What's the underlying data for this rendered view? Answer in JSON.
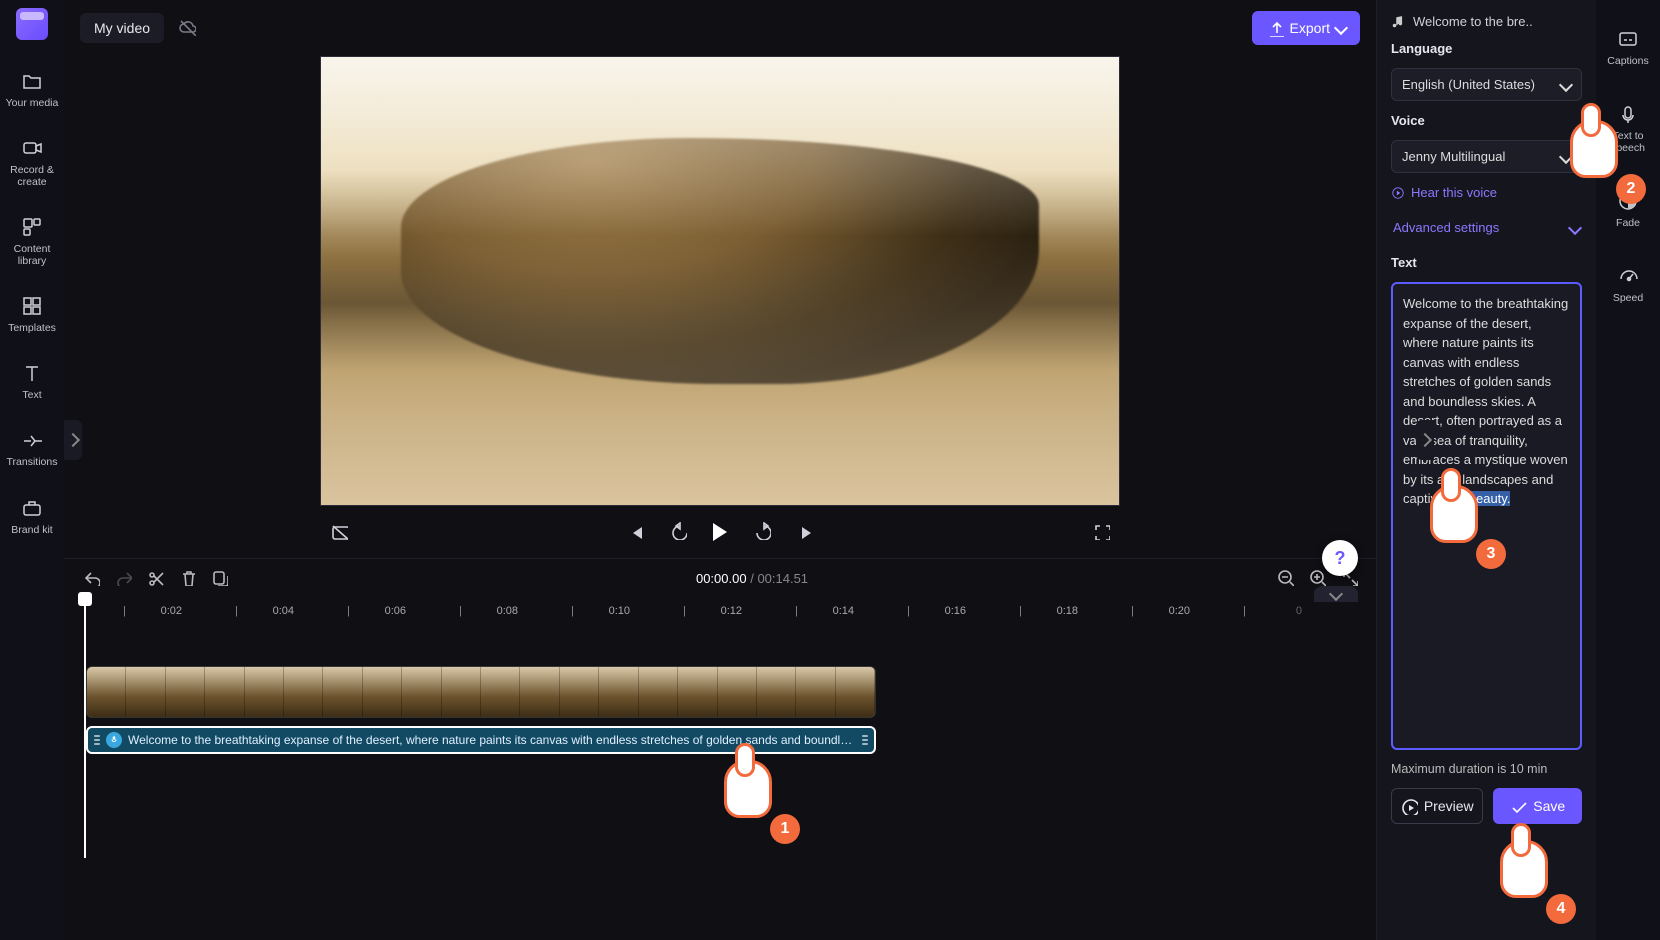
{
  "header": {
    "project_title": "My video",
    "export_label": "Export",
    "aspect_ratio": "16:9"
  },
  "left_rail": {
    "items": [
      {
        "label": "Your media"
      },
      {
        "label": "Record & create"
      },
      {
        "label": "Content library"
      },
      {
        "label": "Templates"
      },
      {
        "label": "Text"
      },
      {
        "label": "Transitions"
      },
      {
        "label": "Brand kit"
      }
    ]
  },
  "right_rail": {
    "items": [
      {
        "label": "Captions"
      },
      {
        "label": "Text to speech"
      },
      {
        "label": "Fade"
      },
      {
        "label": "Speed"
      }
    ]
  },
  "player": {
    "current_time": "00:00.00",
    "duration": "00:14.51"
  },
  "ruler_labels": [
    "0:02",
    "0:04",
    "0:06",
    "0:08",
    "0:10",
    "0:12",
    "0:14",
    "0:16",
    "0:18",
    "0:20"
  ],
  "timeline": {
    "audio_clip_text": "Welcome to the breathtaking expanse of the desert, where nature paints its canvas with endless stretches of golden sands and boundless skies."
  },
  "tts": {
    "header_title": "Welcome to the bre..",
    "language_label": "Language",
    "language_value": "English (United States)",
    "voice_label": "Voice",
    "voice_value": "Jenny Multilingual",
    "hear_label": "Hear this voice",
    "advanced_label": "Advanced settings",
    "text_label": "Text",
    "text_body_prefix": "Welcome to the breathtaking expanse of the desert, where nature paints its canvas with endless stretches of golden sands and boundless skies. A desert, often portrayed as a vast sea of tranquility, embraces a mystique woven by its arid landscapes and captivating ",
    "text_body_selection": "beauty.",
    "hint": "Maximum duration is 10 min",
    "preview_label": "Preview",
    "save_label": "Save"
  },
  "tutorial": {
    "step1": "1",
    "step2": "2",
    "step3": "3",
    "step4": "4"
  },
  "colors": {
    "accent": "#6b57ff",
    "pointer": "#f36b3d"
  }
}
